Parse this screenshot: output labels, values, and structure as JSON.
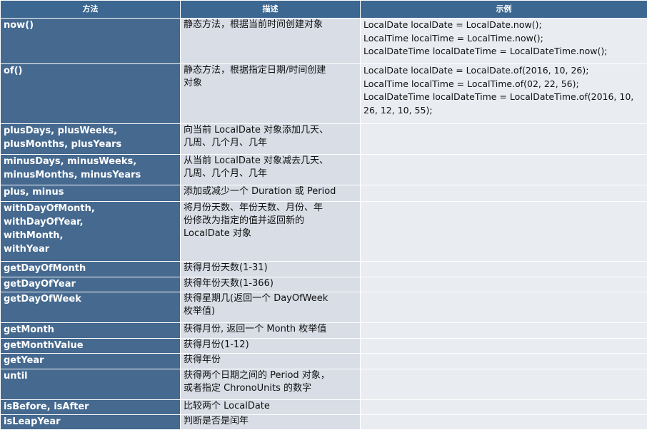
{
  "table": {
    "headers": [
      "方法",
      "描述",
      "示例"
    ],
    "rows": [
      {
        "method": "now()",
        "description": "静态方法，根据当前时间创建对象",
        "example": "LocalDate localDate = LocalDate.now();\nLocalTime localTime = LocalTime.now();\nLocalDateTime localDateTime = LocalDateTime.now();"
      },
      {
        "method": "of()",
        "description": "静态方法，根据指定日期/时间创建\n对象",
        "example": "LocalDate localDate = LocalDate.of(2016, 10, 26);\nLocalTime localTime = LocalTime.of(02, 22, 56);\nLocalDateTime localDateTime = LocalDateTime.of(2016, 10,\n26, 12, 10, 55);"
      },
      {
        "method": "plusDays, plusWeeks,\nplusMonths, plusYears",
        "description": "向当前 LocalDate 对象添加几天、\n几周、几个月、几年",
        "example": ""
      },
      {
        "method": "minusDays, minusWeeks,\nminusMonths, minusYears",
        "description": "从当前 LocalDate 对象减去几天、\n几周、几个月、几年",
        "example": ""
      },
      {
        "method": "plus, minus",
        "description": "添加或减少一个 Duration 或 Period",
        "example": ""
      },
      {
        "method": "withDayOfMonth,\nwithDayOfYear,\nwithMonth,\nwithYear",
        "description": "将月份天数、年份天数、月份、年\n份修改为指定的值并返回新的\nLocalDate 对象",
        "example": ""
      },
      {
        "method": "getDayOfMonth",
        "description": "获得月份天数(1-31)",
        "example": ""
      },
      {
        "method": "getDayOfYear",
        "description": "获得年份天数(1-366)",
        "example": ""
      },
      {
        "method": "getDayOfWeek",
        "description": "获得星期几(返回一个 DayOfWeek\n枚举值)",
        "example": ""
      },
      {
        "method": "getMonth",
        "description": "获得月份, 返回一个 Month 枚举值",
        "example": ""
      },
      {
        "method": "getMonthValue",
        "description": "获得月份(1-12)",
        "example": ""
      },
      {
        "method": "getYear",
        "description": "获得年份",
        "example": ""
      },
      {
        "method": "until",
        "description": "获得两个日期之间的 Period 对象，\n或者指定 ChronoUnits 的数字",
        "example": ""
      },
      {
        "method": "isBefore, isAfter",
        "description": "比较两个 LocalDate",
        "example": ""
      },
      {
        "method": "isLeapYear",
        "description": "判断是否是闰年",
        "example": ""
      }
    ]
  }
}
